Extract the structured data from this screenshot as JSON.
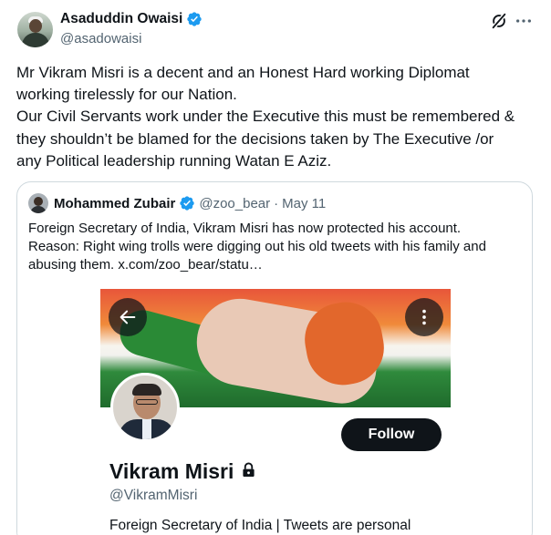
{
  "tweet": {
    "author": {
      "name": "Asaduddin Owaisi",
      "handle": "@asadowaisi",
      "verified": true
    },
    "lines": [
      "Mr Vikram Misri is a decent and an Honest Hard working Diplomat",
      "working tirelessly for our Nation.",
      "Our Civil Servants work under the Executive this must be remembered &",
      "they shouldn’t be blamed for the decisions taken by The Executive /or",
      "any Political leadership running Watan E Aziz."
    ]
  },
  "quote": {
    "author": {
      "name": "Mohammed Zubair",
      "handle": "@zoo_bear",
      "verified": true
    },
    "separator": "·",
    "date": "May 11",
    "lines": [
      "Foreign Secretary of India, Vikram Misri has now protected his account.",
      "Reason: Right wing trolls were digging out his old tweets with his family and",
      "abusing them.  x.com/zoo_bear/statu…"
    ],
    "media": {
      "follow_label": "Follow",
      "profile_name": "Vikram Misri",
      "profile_handle": "@VikramMisri",
      "profile_bio": "Foreign Secretary of India | Tweets are personal",
      "protected": true
    }
  },
  "icons": {
    "verified": "verified-badge-icon",
    "grok": "grok-icon",
    "more": "more-options-icon",
    "back": "back-arrow-icon",
    "lock": "lock-icon"
  },
  "colors": {
    "verified_blue": "#1d9bf0",
    "text_primary": "#0f1419",
    "text_secondary": "#536471",
    "border": "#cfd9de"
  }
}
